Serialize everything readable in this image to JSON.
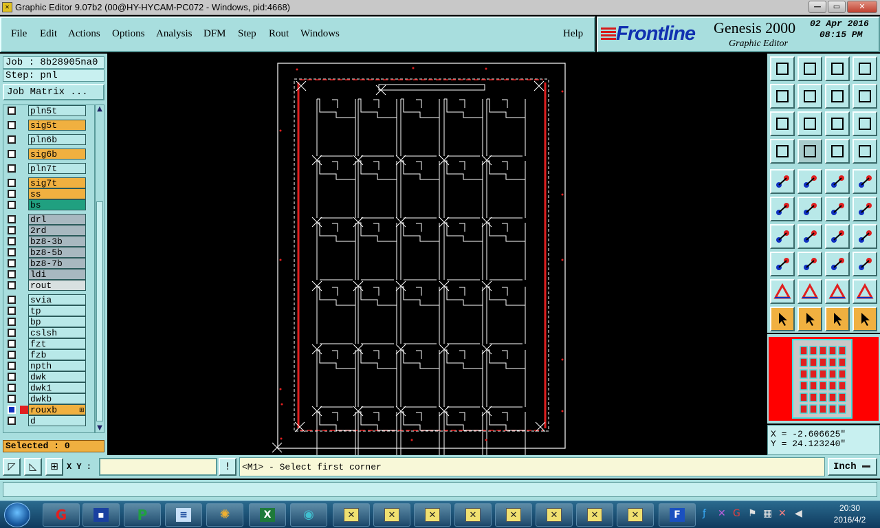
{
  "window": {
    "title": "Graphic Editor 9.07b2 (00@HY-HYCAM-PC072 - Windows, pid:4668)",
    "buttons": [
      "—",
      "▭",
      "✕"
    ]
  },
  "menu": {
    "items": [
      "File",
      "Edit",
      "Actions",
      "Options",
      "Analysis",
      "DFM",
      "Step",
      "Rout",
      "Windows"
    ],
    "help": "Help"
  },
  "logo": {
    "brand": "Frontline",
    "product": "Genesis 2000",
    "subtitle": "Graphic Editor",
    "date": "02 Apr 2016",
    "time": "08:15 PM"
  },
  "left_panel": {
    "job": "Job : 8b28905na0",
    "step": "Step: pnl",
    "job_matrix": "Job Matrix ...",
    "selected": "Selected : 0"
  },
  "layers": [
    {
      "name": "pln5t",
      "style": "plain",
      "gap": 0
    },
    {
      "name": "sig5t",
      "style": "sig",
      "gap": 1
    },
    {
      "name": "pln6b",
      "style": "plain",
      "gap": 1
    },
    {
      "name": "sig6b",
      "style": "sig",
      "gap": 1
    },
    {
      "name": "pln7t",
      "style": "plain",
      "gap": 1
    },
    {
      "name": "sig7t",
      "style": "sig",
      "gap": 1
    },
    {
      "name": "ss",
      "style": "sig",
      "gap": 0
    },
    {
      "name": "bs",
      "style": "green",
      "gap": 0
    },
    {
      "name": "drl",
      "style": "grey",
      "gap": 1
    },
    {
      "name": "2rd",
      "style": "grey",
      "gap": 0
    },
    {
      "name": "bz8-3b",
      "style": "grey",
      "gap": 0
    },
    {
      "name": "bz8-5b",
      "style": "grey",
      "gap": 0
    },
    {
      "name": "bz8-7b",
      "style": "grey",
      "gap": 0
    },
    {
      "name": "ldi",
      "style": "grey",
      "gap": 0
    },
    {
      "name": "rout",
      "style": "light",
      "gap": 0
    },
    {
      "name": "svia",
      "style": "plain",
      "gap": 1
    },
    {
      "name": "tp",
      "style": "plain",
      "gap": 0
    },
    {
      "name": "bp",
      "style": "plain",
      "gap": 0
    },
    {
      "name": "cslsh",
      "style": "plain",
      "gap": 0
    },
    {
      "name": "fzt",
      "style": "plain",
      "gap": 0
    },
    {
      "name": "fzb",
      "style": "plain",
      "gap": 0
    },
    {
      "name": "npth",
      "style": "plain",
      "gap": 0
    },
    {
      "name": "dwk",
      "style": "plain",
      "gap": 0
    },
    {
      "name": "dwk1",
      "style": "plain",
      "gap": 0
    },
    {
      "name": "dwkb",
      "style": "plain",
      "gap": 0
    },
    {
      "name": "rouxb",
      "style": "sig",
      "gap": 0,
      "active": true
    },
    {
      "name": "d",
      "style": "plain",
      "gap": 0
    }
  ],
  "coords": {
    "x": "X = -2.606625\"",
    "y": "Y = 24.123240\""
  },
  "status": {
    "xy_label": "X Y :",
    "xy_value": "",
    "message": "<M1> - Select first corner",
    "unit": "Inch"
  },
  "taskbar": {
    "time": "20:30",
    "date": "2016/4/2"
  },
  "colors": {
    "panel": "#a8dede",
    "signal_layer": "#f0b040",
    "board_line": "#ffffff",
    "rout_line": "#e02020"
  }
}
